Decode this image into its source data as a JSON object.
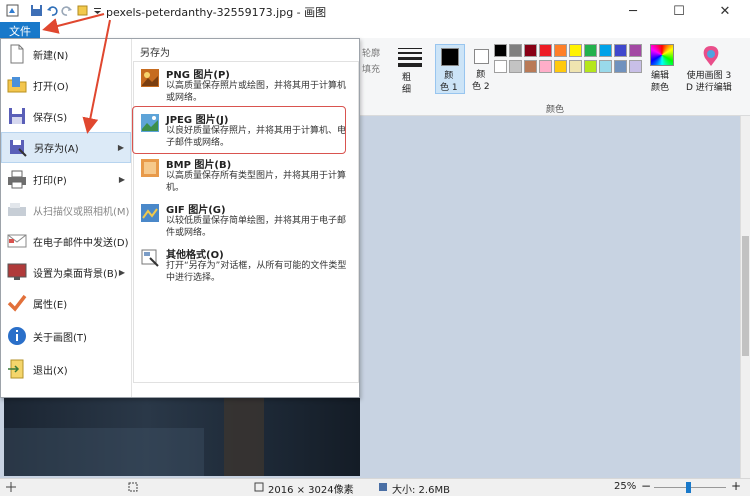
{
  "window": {
    "title": "pexels-peterdanthy-32559173.jpg - 画图",
    "minimize_glyph": "─",
    "maximize_glyph": "☐",
    "close_glyph": "✕"
  },
  "ribbon": {
    "file_tab": "文件",
    "outline_label": "轮廓",
    "fill_label": "填充",
    "size_label": "粗\n细",
    "color1_label": "颜\n色 1",
    "color2_label": "颜\n色 2",
    "colors_group_label": "颜色",
    "edit_colors_label": "编辑\n颜色",
    "paint3d_label": "使用画图 3\nD 进行编辑",
    "palette_row1": [
      "#000000",
      "#7f7f7f",
      "#880015",
      "#ed1c24",
      "#ff7f27",
      "#fff200",
      "#22b14c",
      "#00a2e8",
      "#3f48cc",
      "#a349a4"
    ],
    "palette_row2": [
      "#ffffff",
      "#c3c3c3",
      "#b97a57",
      "#ffaec9",
      "#ffc90e",
      "#efe4b0",
      "#b5e61d",
      "#99d9ea",
      "#7092be",
      "#c8bfe7"
    ]
  },
  "menu": {
    "items": [
      {
        "label": "新建(N)",
        "icon": "new-file-icon"
      },
      {
        "label": "打开(O)",
        "icon": "open-folder-icon"
      },
      {
        "label": "保存(S)",
        "icon": "save-disk-icon"
      },
      {
        "label": "另存为(A)",
        "icon": "save-as-icon"
      },
      {
        "label": "打印(P)",
        "icon": "printer-icon"
      },
      {
        "label": "从扫描仪或照相机(M)",
        "icon": "scanner-icon"
      },
      {
        "label": "在电子邮件中发送(D)",
        "icon": "email-icon"
      },
      {
        "label": "设置为桌面背景(B)",
        "icon": "desktop-background-icon"
      },
      {
        "label": "属性(E)",
        "icon": "checkmark-icon"
      },
      {
        "label": "关于画图(T)",
        "icon": "info-icon"
      },
      {
        "label": "退出(X)",
        "icon": "exit-icon"
      }
    ],
    "arrow_glyph": "▶"
  },
  "save_as": {
    "heading": "另存为",
    "options": [
      {
        "title": "PNG 图片(P)",
        "desc": "以高质量保存照片或绘图，并将其用于计算机或网络。"
      },
      {
        "title": "JPEG 图片(J)",
        "desc": "以良好质量保存照片，并将其用于计算机、电子邮件或网络。"
      },
      {
        "title": "BMP 图片(B)",
        "desc": "以高质量保存所有类型图片，并将其用于计算机。"
      },
      {
        "title": "GIF 图片(G)",
        "desc": "以较低质量保存简单绘图，并将其用于电子邮件或网络。"
      },
      {
        "title": "其他格式(O)",
        "desc": "打开“另存为”对话框，从所有可能的文件类型中进行选择。"
      }
    ]
  },
  "status": {
    "dimensions": "2016 × 3024像素",
    "size": "大小: 2.6MB",
    "zoom": "25%",
    "zoom_minus": "−",
    "zoom_plus": "+"
  },
  "colors": {
    "accent": "#1979ca",
    "highlight_border": "#d9534f",
    "annotation_arrow": "#e0472f",
    "canvas_bg": "#c8d3e2"
  }
}
